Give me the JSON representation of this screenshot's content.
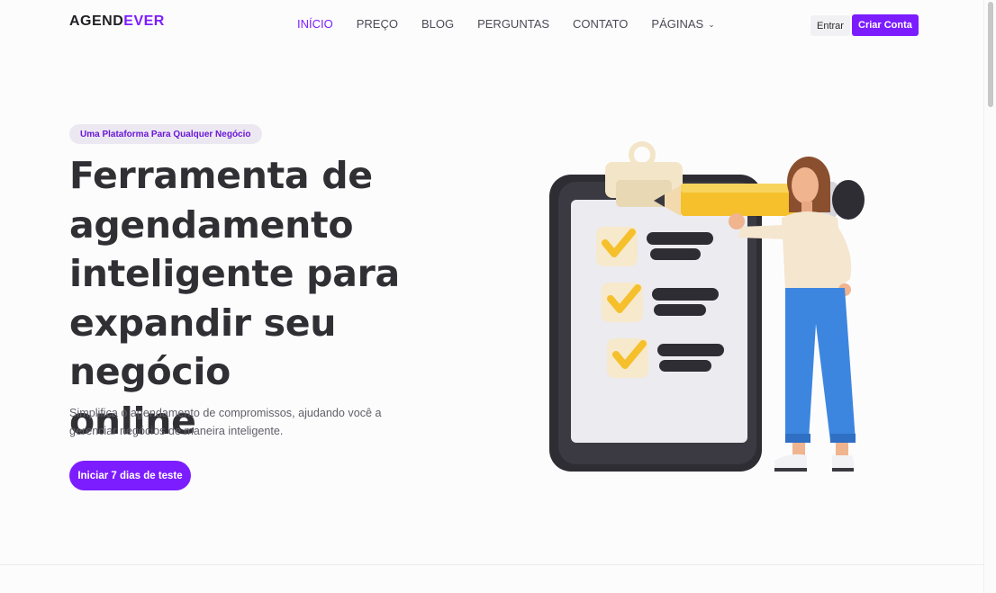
{
  "header": {
    "logo_part1": "AGEND",
    "logo_part2": "EVER",
    "nav": [
      {
        "label": "INÍCIO",
        "active": true
      },
      {
        "label": "PREÇO"
      },
      {
        "label": "BLOG"
      },
      {
        "label": "PERGUNTAS"
      },
      {
        "label": "CONTATO"
      },
      {
        "label": "PÁGINAS",
        "dropdown": true
      }
    ],
    "login_label": "Entrar",
    "signup_label": "Criar Conta"
  },
  "hero": {
    "badge": "Uma Plataforma Para Qualquer Negócio",
    "title_lines": [
      "Ferramenta de",
      "agendamento",
      "inteligente para",
      "expandir seu negócio",
      "online"
    ],
    "subtitle": "Simplifica o agendamento de compromissos, ajudando você a gerenciar negócios de maneira inteligente.",
    "cta_label": "Iniciar 7 dias de teste"
  },
  "colors": {
    "brand": "#7c1dff",
    "text": "#303034"
  },
  "icons": {
    "nav_dropdown": "chevron-down-icon",
    "illustration": "clipboard-checklist-illustration"
  }
}
